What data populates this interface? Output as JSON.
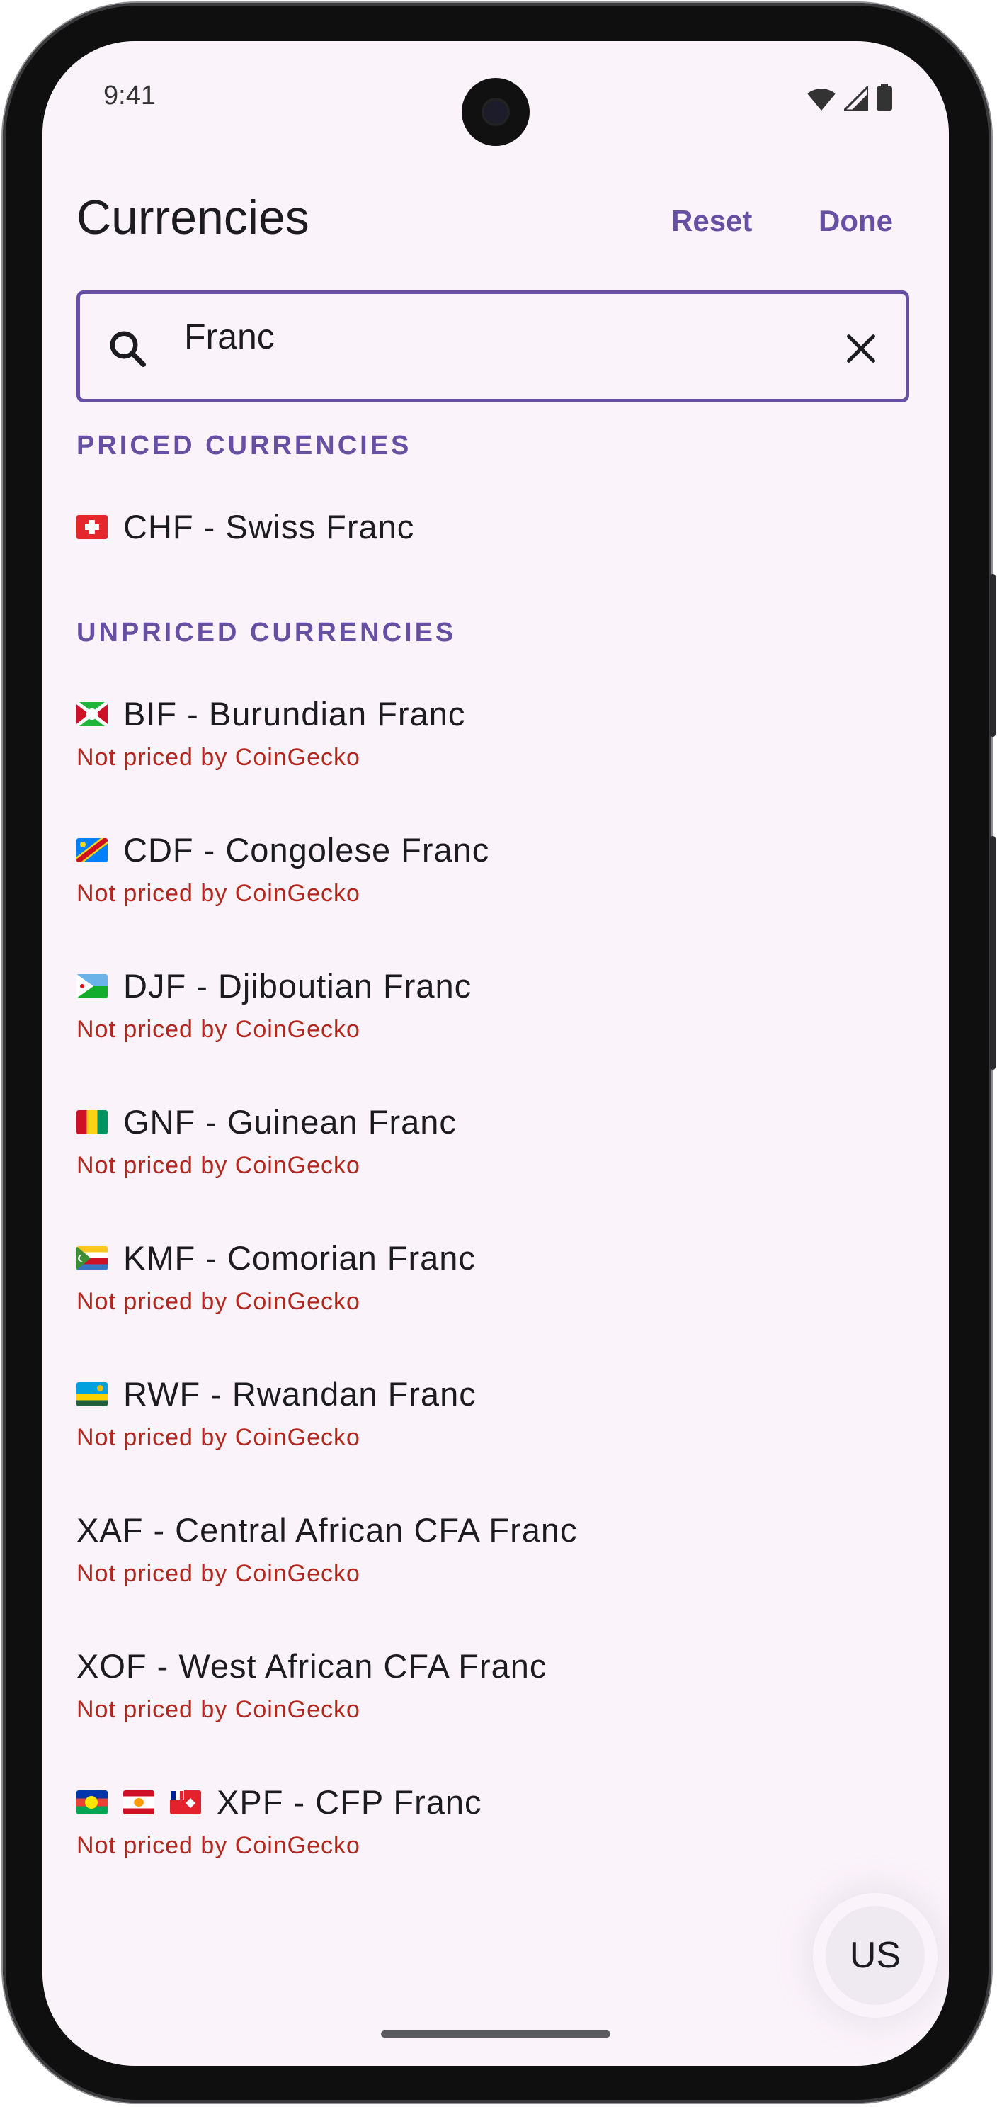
{
  "status": {
    "time": "9:41"
  },
  "header": {
    "title": "Currencies",
    "reset_label": "Reset",
    "done_label": "Done"
  },
  "search": {
    "value": "Franc"
  },
  "sections": {
    "priced": "PRICED CURRENCIES",
    "unpriced": "UNPRICED CURRENCIES"
  },
  "priced": [
    {
      "label": "CHF - Swiss Franc",
      "flag": "switzerland"
    }
  ],
  "unpriced": [
    {
      "label": "BIF - Burundian Franc",
      "sub": "Not priced by CoinGecko",
      "flag": "burundi"
    },
    {
      "label": "CDF - Congolese Franc",
      "sub": "Not priced by CoinGecko",
      "flag": "dr-congo"
    },
    {
      "label": "DJF - Djiboutian Franc",
      "sub": "Not priced by CoinGecko",
      "flag": "djibouti"
    },
    {
      "label": "GNF - Guinean Franc",
      "sub": "Not priced by CoinGecko",
      "flag": "guinea"
    },
    {
      "label": "KMF - Comorian Franc",
      "sub": "Not priced by CoinGecko",
      "flag": "comoros"
    },
    {
      "label": "RWF - Rwandan Franc",
      "sub": "Not priced by CoinGecko",
      "flag": "rwanda"
    },
    {
      "label": "XAF - Central African CFA Franc",
      "sub": "Not priced by CoinGecko"
    },
    {
      "label": "XOF - West African CFA Franc",
      "sub": "Not priced by CoinGecko"
    },
    {
      "label": "XPF - CFP Franc",
      "sub": "Not priced by CoinGecko",
      "flags": [
        "new-caledonia",
        "french-polynesia",
        "wallis-futuna"
      ]
    }
  ],
  "fab": {
    "label": "US"
  },
  "colors": {
    "accent": "#6750a4",
    "error": "#b3261e",
    "surface": "#fbf3fa"
  }
}
